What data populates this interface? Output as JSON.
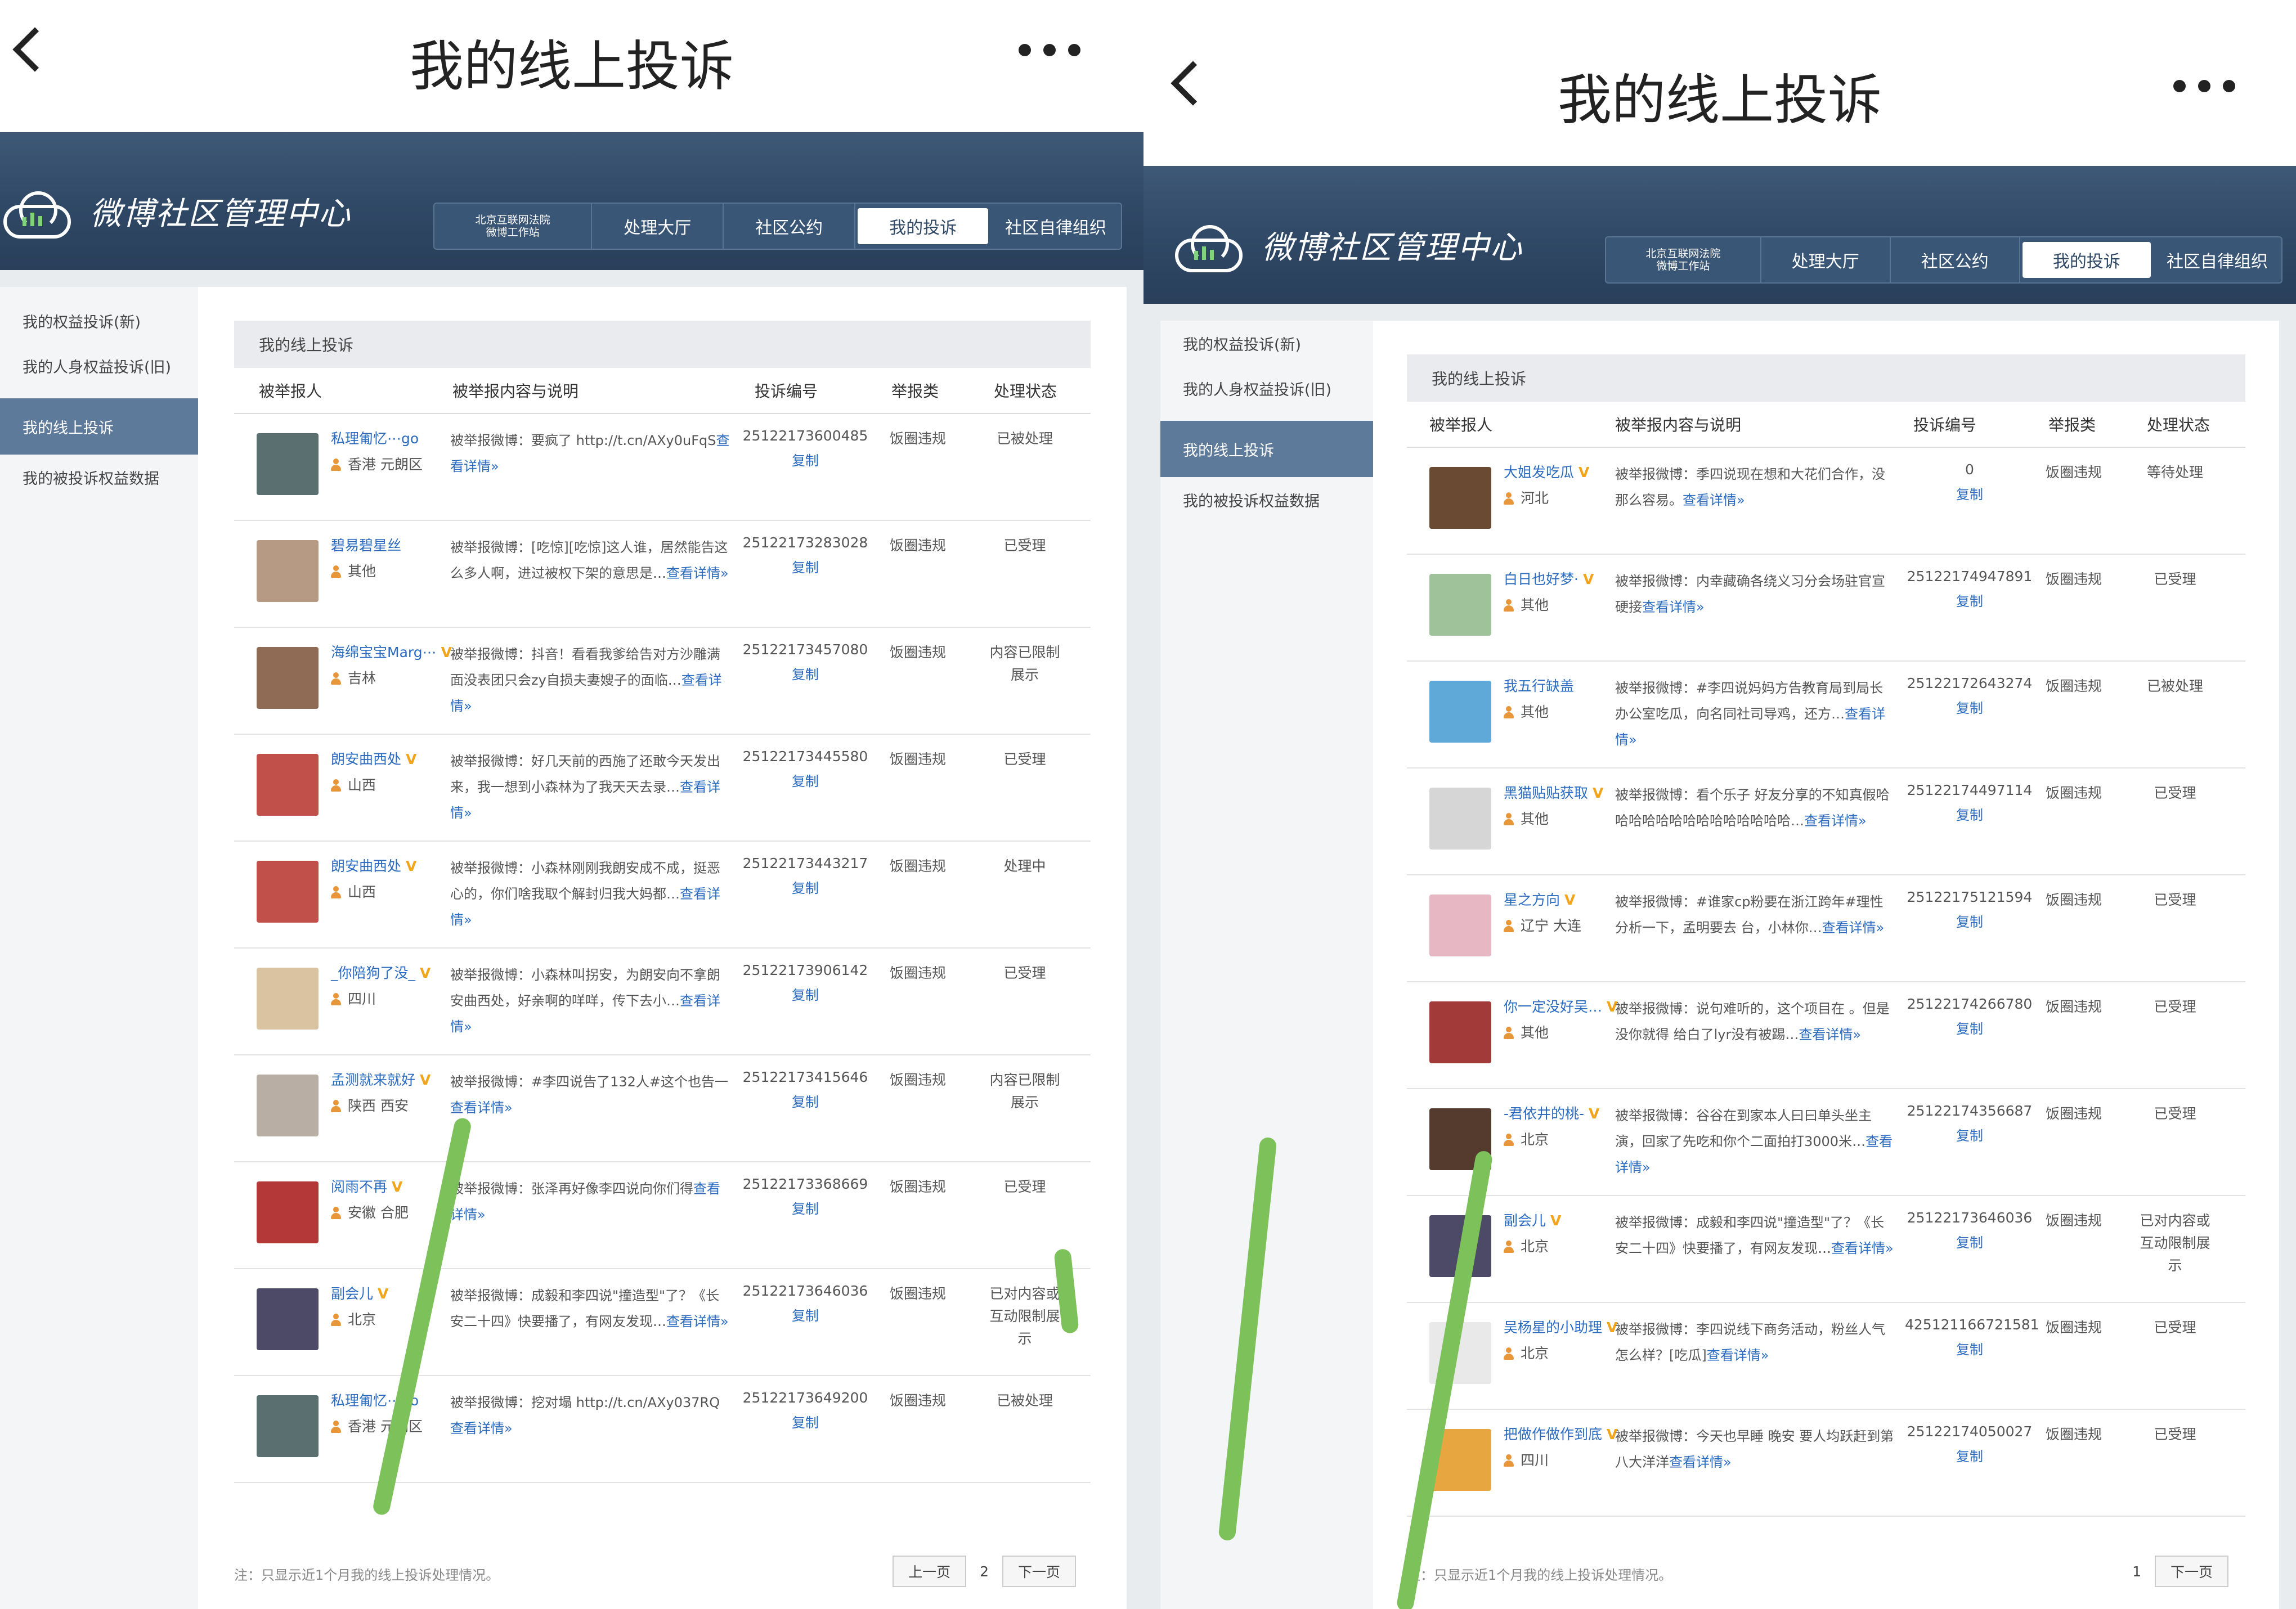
{
  "left": {
    "title": "我的线上投诉",
    "brand": "微博社区管理中心",
    "nav": [
      {
        "label": "北京互联网法院\n微博工作站",
        "small": true
      },
      {
        "label": "处理大厅"
      },
      {
        "label": "社区公约"
      },
      {
        "label": "我的投诉",
        "active": true
      },
      {
        "label": "社区自律组织"
      }
    ],
    "sidebar": [
      {
        "label": "我的权益投诉(新)"
      },
      {
        "label": "我的人身权益投诉(旧)"
      },
      {
        "label": "我的线上投诉",
        "active": true
      },
      {
        "label": "我的被投诉权益数据"
      }
    ],
    "panel_title": "我的线上投诉",
    "headers": {
      "reported": "被举报人",
      "content": "被举报内容与说明",
      "id": "投诉编号",
      "category": "举报类",
      "status": "处理状态"
    },
    "rows": [
      {
        "name": "私理匍忆⋯go",
        "v": false,
        "region": "香港 元朗区",
        "desc": "被举报微博：要疯了 http://t.cn/AXy0uFqS",
        "more": "查看详情»",
        "id": "25122173600485",
        "copy": "复制",
        "cat": "饭圈违规",
        "status": "已被处理",
        "avatar": "#5a6f70"
      },
      {
        "name": "碧易碧星丝",
        "v": false,
        "region": "其他",
        "desc": "被举报微博：[吃惊][吃惊]这人谁，居然能告这么多人啊，进过被权下架的意思是…",
        "more": "查看详情»",
        "id": "25122173283028",
        "copy": "复制",
        "cat": "饭圈违规",
        "status": "已受理",
        "avatar": "#b79a84"
      },
      {
        "name": "海绵宝宝Marg⋯",
        "v": true,
        "region": "吉林",
        "desc": "被举报微博：抖音！看看我爹给告对方沙雕满面没表团只会zy自损夫妻嫂子的面临…",
        "more": "查看详情»",
        "id": "25122173457080",
        "copy": "复制",
        "cat": "饭圈违规",
        "status": "内容已限制展示",
        "avatar": "#8f6a55"
      },
      {
        "name": "朗安曲西处",
        "v": true,
        "region": "山西",
        "desc": "被举报微博：好几天前的西施了还敢今天发出来，我一想到小森林为了我天天去录…",
        "more": "查看详情»",
        "id": "25122173445580",
        "copy": "复制",
        "cat": "饭圈违规",
        "status": "已受理",
        "avatar": "#c2504a"
      },
      {
        "name": "朗安曲西处",
        "v": true,
        "region": "山西",
        "desc": "被举报微博：小森林刚刚我朗安成不成，挺恶心的，你们啥我取个解封归我大妈都…",
        "more": "查看详情»",
        "id": "25122173443217",
        "copy": "复制",
        "cat": "饭圈违规",
        "status": "处理中",
        "avatar": "#c2504a"
      },
      {
        "name": "_你陪狗了没_",
        "v": true,
        "region": "四川",
        "desc": "被举报微博：小森林叫拐安，为朗安向不拿朗安曲西处，好亲啊的咩咩，传下去小…",
        "more": "查看详情»",
        "id": "25122173906142",
        "copy": "复制",
        "cat": "饭圈违规",
        "status": "已受理",
        "avatar": "#d9c3a0"
      },
      {
        "name": "孟测就来就好",
        "v": true,
        "region": "陕西 西安",
        "desc": "被举报微博：#李四说告了132人#这个也告一",
        "more": "查看详情»",
        "id": "25122173415646",
        "copy": "复制",
        "cat": "饭圈违规",
        "status": "内容已限制展示",
        "avatar": "#b8aea4"
      },
      {
        "name": "阅雨不再",
        "v": true,
        "region": "安徽 合肥",
        "desc": "被举报微博：张泽再好像李四说向你们得",
        "more": "查看详情»",
        "id": "25122173368669",
        "copy": "复制",
        "cat": "饭圈违规",
        "status": "已受理",
        "avatar": "#b53838"
      },
      {
        "name": "副会儿",
        "v": true,
        "region": "北京",
        "desc": "被举报微博：成毅和李四说\"撞造型\"了？《长安二十四》快要播了，有网友发现…",
        "more": "查看详情»",
        "id": "25122173646036",
        "copy": "复制",
        "cat": "饭圈违规",
        "status": "已对内容或互动限制展示",
        "avatar": "#4c4a66"
      },
      {
        "name": "私理匍忆⋯go",
        "v": false,
        "region": "香港 元朗区",
        "desc": "被举报微博：挖对塌 http://t.cn/AXy037RQ",
        "more": "查看详情»",
        "id": "25122173649200",
        "copy": "复制",
        "cat": "饭圈违规",
        "status": "已被处理",
        "avatar": "#5a6f70"
      }
    ],
    "footer_note": "注：只显示近1个月我的线上投诉处理情况。",
    "pager": {
      "prev": "上一页",
      "page": "2",
      "next": "下一页"
    }
  },
  "right": {
    "title": "我的线上投诉",
    "brand": "微博社区管理中心",
    "nav": [
      {
        "label": "北京互联网法院\n微博工作站",
        "small": true
      },
      {
        "label": "处理大厅"
      },
      {
        "label": "社区公约"
      },
      {
        "label": "我的投诉",
        "active": true
      },
      {
        "label": "社区自律组织"
      }
    ],
    "sidebar": [
      {
        "label": "我的权益投诉(新)"
      },
      {
        "label": "我的人身权益投诉(旧)"
      },
      {
        "label": "我的线上投诉",
        "active": true
      },
      {
        "label": "我的被投诉权益数据"
      }
    ],
    "panel_title": "我的线上投诉",
    "headers": {
      "reported": "被举报人",
      "content": "被举报内容与说明",
      "id": "投诉编号",
      "category": "举报类",
      "status": "处理状态"
    },
    "rows": [
      {
        "name": "大姐发吃瓜",
        "v": true,
        "region": "河北",
        "desc": "被举报微博：季四说现在想和大花们合作，没那么容易。",
        "more": "查看详情»",
        "id": "0",
        "copy": "复制",
        "cat": "饭圈违规",
        "status": "等待处理",
        "avatar": "#6b4a34"
      },
      {
        "name": "白日也好梦·",
        "v": true,
        "region": "其他",
        "desc": "被举报微博：内幸藏确各绕义习分会场驻官宣硬接",
        "more": "查看详情»",
        "id": "25122174947891",
        "copy": "复制",
        "cat": "饭圈违规",
        "status": "已受理",
        "avatar": "#9fc29a"
      },
      {
        "name": "我五行缺盖",
        "v": false,
        "region": "其他",
        "desc": "被举报微博：#李四说妈妈方告教育局到局长办公室吃瓜，向名同社司导鸡，还方…",
        "more": "查看详情»",
        "id": "25122172643274",
        "copy": "复制",
        "cat": "饭圈违规",
        "status": "已被处理",
        "avatar": "#5fa9d8"
      },
      {
        "name": "黑猫贴贴获取",
        "v": true,
        "region": "其他",
        "desc": "被举报微博：看个乐子 好友分享的不知真假哈哈哈哈哈哈哈哈哈哈哈哈哈哈…",
        "more": "查看详情»",
        "id": "25122174497114",
        "copy": "复制",
        "cat": "饭圈违规",
        "status": "已受理",
        "avatar": "#d6d6d6"
      },
      {
        "name": "星之方向",
        "v": true,
        "region": "辽宁 大连",
        "desc": "被举报微博：#谁家cp粉要在浙江跨年#理性分析一下，孟明要去 台，小林你…",
        "more": "查看详情»",
        "id": "25122175121594",
        "copy": "复制",
        "cat": "饭圈违规",
        "status": "已受理",
        "avatar": "#e7b7c3"
      },
      {
        "name": "你一定没好吴…",
        "v": true,
        "region": "其他",
        "desc": "被举报微博：说句难听的，这个项目在 。但是没你就得 给白了lyr没有被踢…",
        "more": "查看详情»",
        "id": "25122174266780",
        "copy": "复制",
        "cat": "饭圈违规",
        "status": "已受理",
        "avatar": "#a33a3a"
      },
      {
        "name": "-君依井的桃-",
        "v": true,
        "region": "北京",
        "desc": "被举报微博：谷谷在到家本人曰曰单头坐主演，回家了先吃和你个二面拍打3000米…",
        "more": "查看详情»",
        "id": "25122174356687",
        "copy": "复制",
        "cat": "饭圈违规",
        "status": "已受理",
        "avatar": "#553a2e"
      },
      {
        "name": "副会儿",
        "v": true,
        "region": "北京",
        "desc": "被举报微博：成毅和李四说\"撞造型\"了？《长安二十四》快要播了，有网友发现…",
        "more": "查看详情»",
        "id": "25122173646036",
        "copy": "复制",
        "cat": "饭圈违规",
        "status": "已对内容或互动限制展示",
        "avatar": "#4c4a66"
      },
      {
        "name": "吴杨星的小助理",
        "v": true,
        "region": "北京",
        "desc": "被举报微博：李四说线下商务活动，粉丝人气怎么样？[吃瓜]",
        "more": "查看详情»",
        "id": "425121166721581",
        "copy": "复制",
        "cat": "饭圈违规",
        "status": "已受理",
        "avatar": "#e9e9e9"
      },
      {
        "name": "把做作做作到底",
        "v": true,
        "region": "四川",
        "desc": "被举报微博：今天也早睡 晚安 要人均跃赶到第八大洋洋",
        "more": "查看详情»",
        "id": "25122174050027",
        "copy": "复制",
        "cat": "饭圈违规",
        "status": "已受理",
        "avatar": "#e8a640"
      }
    ],
    "footer_note": "注：只显示近1个月我的线上投诉处理情况。",
    "pager": {
      "page": "1",
      "next": "下一页"
    }
  },
  "colors": {
    "header": "#2f4865",
    "sidebar_active": "#5e7a9a",
    "link": "#2a6bc0",
    "v_badge": "#f2a51a",
    "stroke": "#7dc15a"
  }
}
